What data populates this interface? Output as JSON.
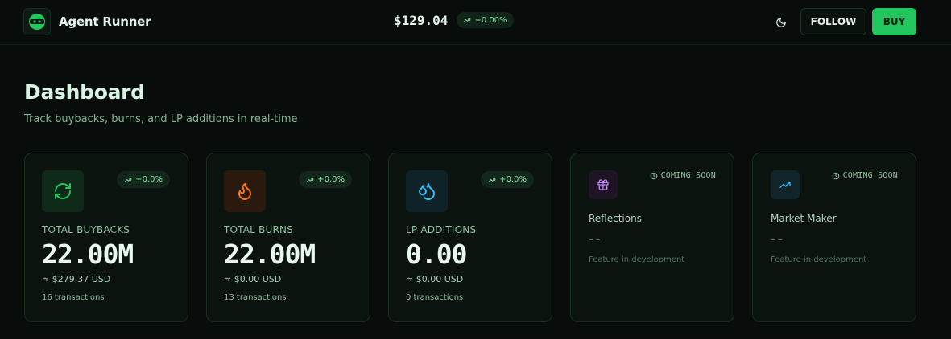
{
  "header": {
    "app_name": "Agent Runner",
    "price": "$129.04",
    "price_change": "+0.00%",
    "follow_label": "FOLLOW",
    "buy_label": "BUY"
  },
  "page": {
    "title": "Dashboard",
    "subtitle": "Track buybacks, burns, and LP additions in real-time"
  },
  "stats": [
    {
      "icon": "refresh-icon",
      "trend": "+0.0%",
      "label": "TOTAL BUYBACKS",
      "value": "22.00M",
      "usd": "≈ $279.37 USD",
      "transactions": "16 transactions"
    },
    {
      "icon": "flame-icon",
      "trend": "+0.0%",
      "label": "TOTAL BURNS",
      "value": "22.00M",
      "usd": "≈ $0.00 USD",
      "transactions": "13 transactions"
    },
    {
      "icon": "droplets-icon",
      "trend": "+0.0%",
      "label": "LP ADDITIONS",
      "value": "0.00",
      "usd": "≈ $0.00 USD",
      "transactions": "0 transactions"
    }
  ],
  "upcoming": [
    {
      "icon": "gift-icon",
      "badge": "COMING SOON",
      "label": "Reflections",
      "value": "--",
      "note": "Feature in development"
    },
    {
      "icon": "trending-up-icon",
      "badge": "COMING SOON",
      "label": "Market Maker",
      "value": "--",
      "note": "Feature in development"
    }
  ],
  "colors": {
    "background": "#080d0b",
    "accent": "#22c55e",
    "buybacks_icon": "#22c55e",
    "burns_icon": "#f97316",
    "lp_icon": "#38bdf8",
    "reflections_icon": "#c084fc",
    "market_maker_icon": "#38bdf8"
  }
}
